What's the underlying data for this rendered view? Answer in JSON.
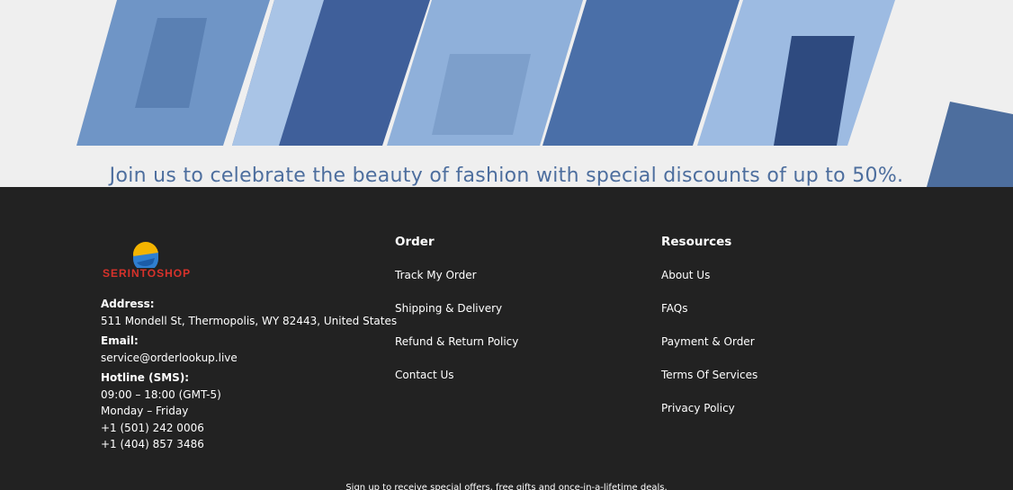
{
  "banner": {
    "tagline": "Join us to celebrate the beauty of fashion with special discounts of up to 50%.",
    "accent_color": "#4d6e9e"
  },
  "brand": {
    "logo_text": "SERINTOSHOP"
  },
  "contact": {
    "address_label": "Address:",
    "address": "511 Mondell St, Thermopolis, WY 82443, United States",
    "email_label": "Email:",
    "email": "service@orderlookup.live",
    "hotline_label": "Hotline (SMS):",
    "hours": "09:00 – 18:00 (GMT-5)",
    "days": "Monday – Friday",
    "phones": [
      "+1 (501) 242 0006",
      "+1 (404) 857 3486"
    ]
  },
  "order": {
    "title": "Order",
    "links": [
      "Track My Order",
      "Shipping & Delivery",
      "Refund & Return Policy",
      "Contact Us"
    ]
  },
  "resources": {
    "title": "Resources",
    "links": [
      "About Us",
      "FAQs",
      "Payment & Order",
      "Terms Of Services",
      "Privacy Policy"
    ]
  },
  "signup_text": "Sign up to receive special offers, free gifts and once-in-a-lifetime deals."
}
